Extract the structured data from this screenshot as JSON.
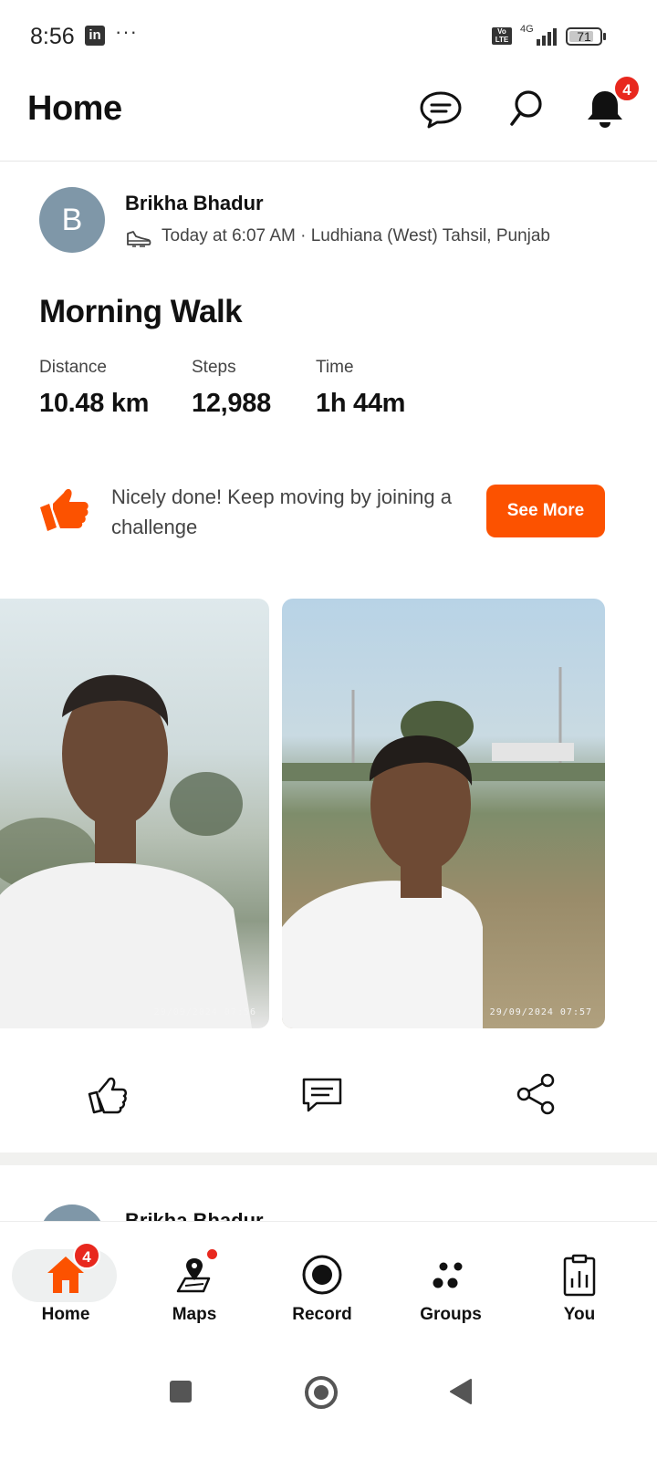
{
  "status_bar": {
    "time": "8:56",
    "notification_icon": "linkedin-icon",
    "more": "···",
    "network": "4G",
    "volte": "Vo\nLTE",
    "battery": "71"
  },
  "header": {
    "title": "Home",
    "icons": [
      "chat-icon",
      "search-icon",
      "bell-icon"
    ],
    "notification_count": "4"
  },
  "activity": {
    "avatar_initial": "B",
    "athlete": "Brikha Bhadur",
    "meta": "Today at 6:07 AM · Ludhiana (West) Tahsil, Punjab",
    "title": "Morning Walk",
    "stats": [
      {
        "label": "Distance",
        "value": "10.48 km"
      },
      {
        "label": "Steps",
        "value": "12,988"
      },
      {
        "label": "Time",
        "value": "1h 44m"
      }
    ],
    "challenge_text": "Nicely done! Keep moving by joining a challenge",
    "see_more": "See More",
    "photos": [
      {
        "stamp": "29/09/2024 07:56"
      },
      {
        "stamp": "29/09/2024 07:57"
      }
    ]
  },
  "next_activity": {
    "athlete": "Brikha Bhadur"
  },
  "bottom_nav": {
    "items": [
      {
        "label": "Home",
        "icon": "home-icon",
        "badge": "4"
      },
      {
        "label": "Maps",
        "icon": "map-icon"
      },
      {
        "label": "Record",
        "icon": "record-icon"
      },
      {
        "label": "Groups",
        "icon": "groups-icon"
      },
      {
        "label": "You",
        "icon": "clipboard-chart-icon"
      }
    ]
  },
  "colors": {
    "accent": "#fc5200",
    "badge": "#e8281e",
    "avatar": "#7f97a8"
  }
}
